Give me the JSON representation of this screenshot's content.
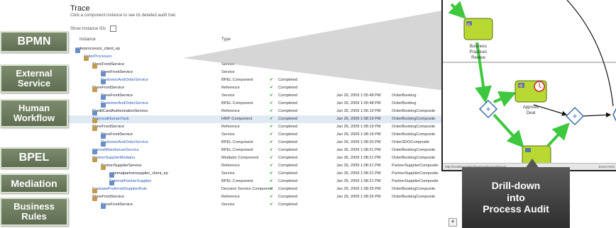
{
  "trace": {
    "title": "Trace",
    "hint": "Click a component instance to see its detailed audit trail.",
    "show_instance_ids": "Show Instance IDs",
    "columns": {
      "instance": "Instance",
      "type": "Type"
    }
  },
  "rows": [
    {
      "name": "orderprocessor_client_ep",
      "type": "",
      "state": "",
      "time": "",
      "comp": ""
    },
    {
      "name": "OrderProcessor",
      "type": "",
      "state": "",
      "time": "",
      "comp": ""
    },
    {
      "name": "StoreFrontService",
      "type": "Service",
      "state": "",
      "time": "",
      "comp": ""
    },
    {
      "name": "StoreFrontService",
      "type": "Service",
      "state": "",
      "time": "",
      "comp": ""
    },
    {
      "name": "CustomerAndOrderService",
      "type": "BPEL Component",
      "state": "Completed",
      "time": "",
      "comp": ""
    },
    {
      "name": "StoreFrontService",
      "type": "Reference",
      "state": "Completed",
      "time": "",
      "comp": ""
    },
    {
      "name": "StoreFrontService",
      "type": "Service",
      "state": "Completed",
      "time": "Jan 26, 2009 1:05:48 PM",
      "comp": "OrderBooking"
    },
    {
      "name": "CustomerAndOrderService",
      "type": "BPEL Component",
      "state": "Completed",
      "time": "Jan 26, 2009 1:05:48 PM",
      "comp": "OrderBooking"
    },
    {
      "name": "CreditCardAuthorizationService",
      "type": "Reference",
      "state": "Completed",
      "time": "Jan 26, 2009 1:06:19 PM",
      "comp": "OrderBookingComposite"
    },
    {
      "name": "ApprovalHumanTask",
      "type": "HWF Component",
      "state": "Completed",
      "time": "Jan 26, 2009 1:08:19 PM",
      "comp": "OrderBookingComposite"
    },
    {
      "name": "StoreFrontService",
      "type": "Reference",
      "state": "Completed",
      "time": "Jan 26, 2009 1:08:19 PM",
      "comp": "OrderBookingComposite"
    },
    {
      "name": "StoreFrontService",
      "type": "Service",
      "state": "Completed",
      "time": "Jan 26, 2009 1:08:19 PM",
      "comp": "OrderBookingComposite"
    },
    {
      "name": "CustomerAndOrderService",
      "type": "BPEL Component",
      "state": "Completed",
      "time": "Jan 26, 2009 1:08:20 PM",
      "comp": "OrderSDOComposite"
    },
    {
      "name": "InternalWarehouseService",
      "type": "BPEL Component",
      "state": "Completed",
      "time": "Jan 26, 2009 1:08:21 PM",
      "comp": "OrderBookingComposite"
    },
    {
      "name": "PartnerSupplierMediator",
      "type": "Mediator Component",
      "state": "Completed",
      "time": "Jan 26, 2009 1:08:21 PM",
      "comp": "OrderBookingComposite"
    },
    {
      "name": "PartnerSupplierService",
      "type": "Reference",
      "state": "Completed",
      "time": "Jan 26, 2009 1:08:21 PM",
      "comp": "PartnerSupplierComposite"
    },
    {
      "name": "externalpartnersupplier_client_ep",
      "type": "Service",
      "state": "Completed",
      "time": "Jan 26, 2009 1:08:21 PM",
      "comp": "PartnerSupplierComposite"
    },
    {
      "name": "ExternalPartnerSupplier",
      "type": "BPEL Component",
      "state": "Completed",
      "time": "Jan 26, 2009 1:08:21 PM",
      "comp": "PartnerSupplierComposite"
    },
    {
      "name": "EvaluatePreferredSupplierRule",
      "type": "Decision Service Component",
      "state": "Completed",
      "time": "Jan 26, 2009 1:08:25 PM",
      "comp": "OrderBookingComposite"
    },
    {
      "name": "StoreFrontService",
      "type": "Reference",
      "state": "Completed",
      "time": "Jan 26, 2009 1:08:26 PM",
      "comp": "OrderBookingComposite"
    },
    {
      "name": "StoreFrontService",
      "type": "Service",
      "state": "Completed",
      "time": "",
      "comp": ""
    }
  ],
  "badges": {
    "bpmn": "BPMN",
    "external_service": [
      "External",
      "Service"
    ],
    "human_workflow": [
      "Human",
      "Workflow"
    ],
    "bpel": "BPEL",
    "mediation": "Mediation",
    "business_rules": [
      "Business",
      "Rules"
    ]
  },
  "diagram": {
    "task1": [
      "Business",
      "Practices",
      "Review"
    ],
    "task2": [
      "Approve",
      "Deal"
    ],
    "status_left": "http://localhost:8001/bpm/workspace/faces/...",
    "status_right": "Zoom Here"
  },
  "callout": [
    "Drill-down",
    "into",
    "Process Audit"
  ],
  "colors": {
    "badge": "#6d7b60",
    "task": "#b8d832",
    "flow": "#3ec83e",
    "callout": "#404040"
  }
}
